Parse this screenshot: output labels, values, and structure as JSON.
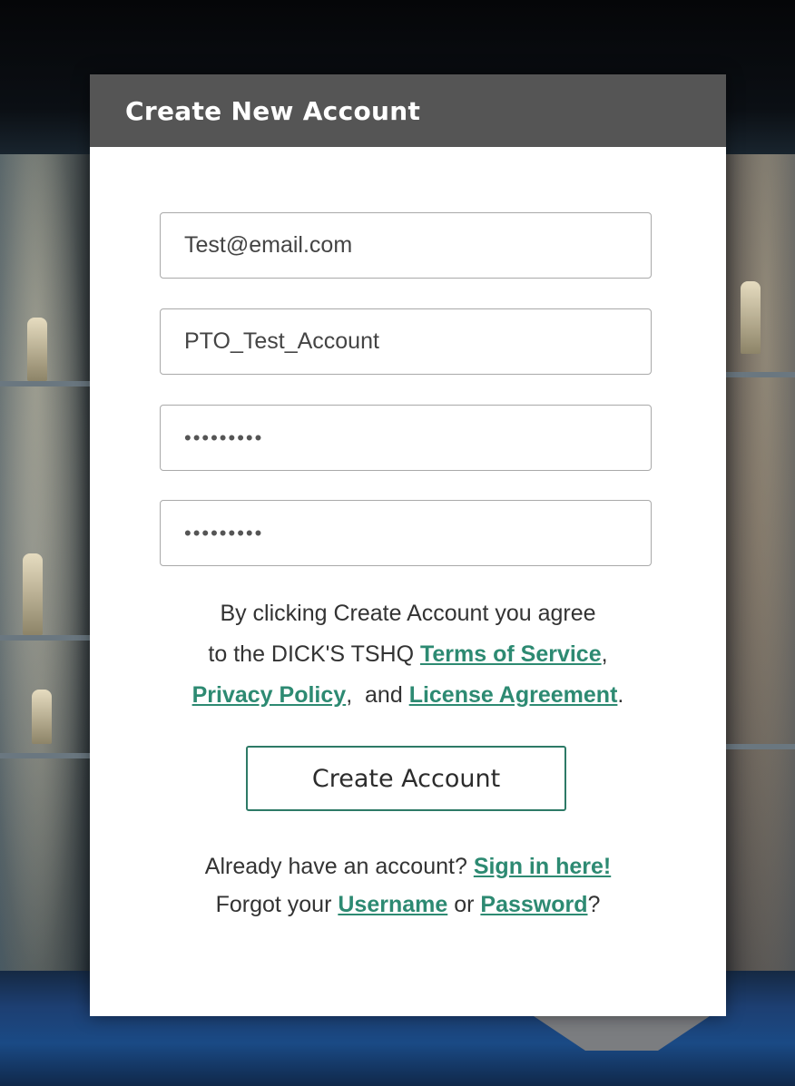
{
  "header": {
    "title": "Create New Account"
  },
  "form": {
    "email_value": "Test@email.com",
    "username_value": "PTO_Test_Account",
    "password_value": "123456789",
    "confirm_password_value": "123456789"
  },
  "agreement": {
    "line1": "By clicking Create Account you agree",
    "line2_prefix": "to the DICK'S TSHQ ",
    "terms_link": "Terms of Service",
    "comma1": ",",
    "privacy_link": "Privacy Policy",
    "and_text": ",  and ",
    "license_link": "License Agreement",
    "period": "."
  },
  "submit": {
    "label": "Create Account"
  },
  "footer": {
    "already_text": "Already have an account? ",
    "sign_in_link": "Sign in here!",
    "forgot_prefix": "Forgot your ",
    "username_link": "Username",
    "or_text": " or ",
    "password_link": "Password",
    "question_mark": "?"
  },
  "colors": {
    "header_bg": "#555555",
    "link": "#2d8a72",
    "button_border": "#2d7a66"
  }
}
